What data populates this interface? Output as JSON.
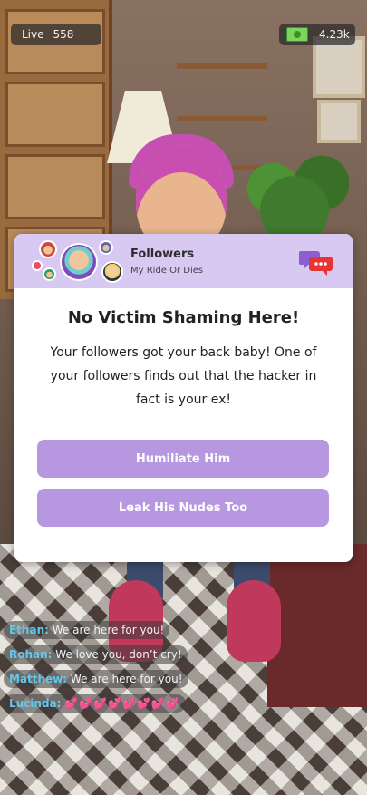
{
  "hud": {
    "live_label": "Live",
    "live_count": "558",
    "money_icon": "cash-icon",
    "money_amount": "4.23k"
  },
  "dialog": {
    "header": {
      "title": "Followers",
      "subtitle": "My Ride Or Dies",
      "chat_icon": "chat-bubbles-icon"
    },
    "title": "No Victim Shaming Here!",
    "body": "Your followers got your back baby! One of your followers finds out that the hacker in fact is your ex!",
    "choices": [
      {
        "label": "Humiliate Him"
      },
      {
        "label": "Leak His Nudes Too"
      }
    ]
  },
  "chat": [
    {
      "name": "Ethan:",
      "text": "We are here for you!"
    },
    {
      "name": "Rohan:",
      "text": "We love you, don’t cry!"
    },
    {
      "name": "Matthew:",
      "text": "We are here for you!"
    },
    {
      "name": "Lucinda:",
      "text": "💕💕💕💕💕💕💕💕"
    }
  ],
  "colors": {
    "header_bg": "#d8c9f2",
    "button_bg": "#b797e0",
    "chat_name": "#66c5e8"
  }
}
